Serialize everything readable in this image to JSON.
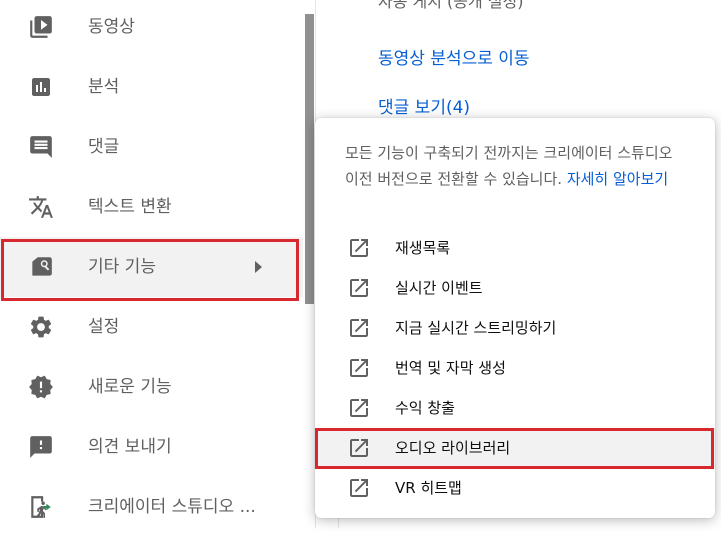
{
  "sidebar": {
    "items": [
      {
        "label": "동영상",
        "icon": "video-icon"
      },
      {
        "label": "분석",
        "icon": "analytics-icon"
      },
      {
        "label": "댓글",
        "icon": "comment-icon"
      },
      {
        "label": "텍스트 변환",
        "icon": "translate-icon"
      },
      {
        "label": "기타 기능",
        "icon": "other-features-icon"
      },
      {
        "label": "설정",
        "icon": "gear-icon"
      },
      {
        "label": "새로운 기능",
        "icon": "alert-badge-icon"
      },
      {
        "label": "의견 보내기",
        "icon": "feedback-icon"
      },
      {
        "label": "크리에이터 스튜디오 ...",
        "icon": "exit-icon"
      }
    ]
  },
  "content": {
    "cut_text": "자동 게시 (공개 설정)",
    "link_analytics": "동영상 분석으로 이동",
    "link_comments": "댓글 보기(4)"
  },
  "popup": {
    "notice": "모든 기능이 구축되기 전까지는 크리에이터 스튜디오 이전 버전으로 전환할 수 있습니다.",
    "learn_more": "자세히 알아보기",
    "items": [
      {
        "label": "재생목록"
      },
      {
        "label": "실시간 이벤트"
      },
      {
        "label": "지금 실시간 스트리밍하기"
      },
      {
        "label": "번역 및 자막 생성"
      },
      {
        "label": "수익 창출"
      },
      {
        "label": "오디오 라이브러리"
      },
      {
        "label": "VR 히트맵"
      }
    ]
  },
  "colors": {
    "highlight_border": "#d7282f",
    "link": "#065fd4",
    "icon": "#606060"
  }
}
